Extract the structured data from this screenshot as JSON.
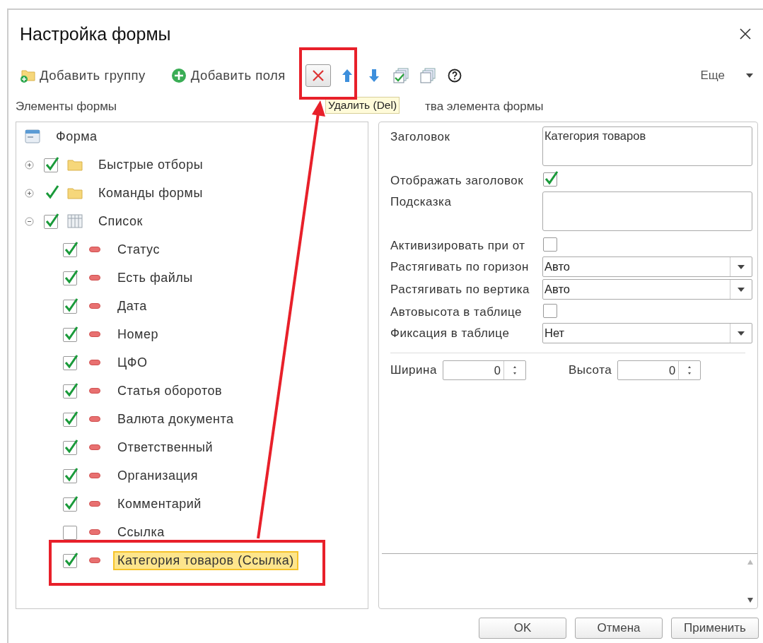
{
  "dialog": {
    "title": "Настройка формы"
  },
  "toolbar": {
    "items": [
      {
        "kind": "add-group",
        "label": "Добавить группу"
      },
      {
        "kind": "add-fields",
        "label": "Добавить поля"
      },
      {
        "kind": "delete"
      },
      {
        "kind": "up"
      },
      {
        "kind": "down"
      },
      {
        "kind": "check-all"
      },
      {
        "kind": "uncheck-all"
      },
      {
        "kind": "help"
      }
    ],
    "more": "Еще"
  },
  "tooltip": "Удалить (Del)",
  "tree_header": "Элементы формы",
  "properties_header": "тва элемента формы",
  "tree": {
    "kind": "form",
    "label": "Форма",
    "children": [
      {
        "kind": "folder",
        "label": "Быстрые отборы",
        "checked": true,
        "boxed": true,
        "expanded": false,
        "selected": false
      },
      {
        "kind": "folder",
        "label": "Команды формы",
        "checked": true,
        "boxed": false,
        "expanded": false,
        "selected": false
      },
      {
        "kind": "table",
        "label": "Список",
        "checked": true,
        "boxed": true,
        "expanded": true,
        "selected": false,
        "children": [
          {
            "kind": "field",
            "label": "Статус",
            "checked": true,
            "boxed": true,
            "selected": false
          },
          {
            "kind": "field",
            "label": "Есть файлы",
            "checked": true,
            "boxed": true,
            "selected": false
          },
          {
            "kind": "field",
            "label": "Дата",
            "checked": true,
            "boxed": true,
            "selected": false
          },
          {
            "kind": "field",
            "label": "Номер",
            "checked": true,
            "boxed": true,
            "selected": false
          },
          {
            "kind": "field",
            "label": "ЦФО",
            "checked": true,
            "boxed": true,
            "selected": false
          },
          {
            "kind": "field",
            "label": "Статья оборотов",
            "checked": true,
            "boxed": true,
            "selected": false
          },
          {
            "kind": "field",
            "label": "Валюта документа",
            "checked": true,
            "boxed": true,
            "selected": false
          },
          {
            "kind": "field",
            "label": "Ответственный",
            "checked": true,
            "boxed": true,
            "selected": false
          },
          {
            "kind": "field",
            "label": "Организация",
            "checked": true,
            "boxed": true,
            "selected": false
          },
          {
            "kind": "field",
            "label": "Комментарий",
            "checked": true,
            "boxed": true,
            "selected": false
          },
          {
            "kind": "field",
            "label": "Ссылка",
            "checked": false,
            "boxed": true,
            "selected": false
          },
          {
            "kind": "field",
            "label": "Категория товаров (Ссылка)",
            "checked": true,
            "boxed": true,
            "selected": true
          }
        ]
      }
    ]
  },
  "properties": [
    {
      "kind": "textarea",
      "label": "Заголовок",
      "value": "Категория товаров"
    },
    {
      "kind": "checkbox",
      "label": "Отображать заголовок",
      "checked": true
    },
    {
      "kind": "textarea",
      "label": "Подсказка"
    },
    {
      "kind": "checkbox",
      "label": "Активизировать при от",
      "checked": false
    },
    {
      "kind": "select",
      "label": "Растягивать по горизон",
      "value": "Авто"
    },
    {
      "kind": "select",
      "label": "Растягивать по вертика",
      "value": "Авто"
    },
    {
      "kind": "checkbox",
      "label": "Автовысота в таблице",
      "checked": false
    },
    {
      "kind": "select",
      "label": "Фиксация в таблице",
      "value": "Нет"
    }
  ],
  "size": [
    {
      "label": "Ширина",
      "value": "0"
    },
    {
      "label": "Высота",
      "value": "0"
    }
  ],
  "buttons": [
    "OK",
    "Отмена",
    "Применить"
  ]
}
